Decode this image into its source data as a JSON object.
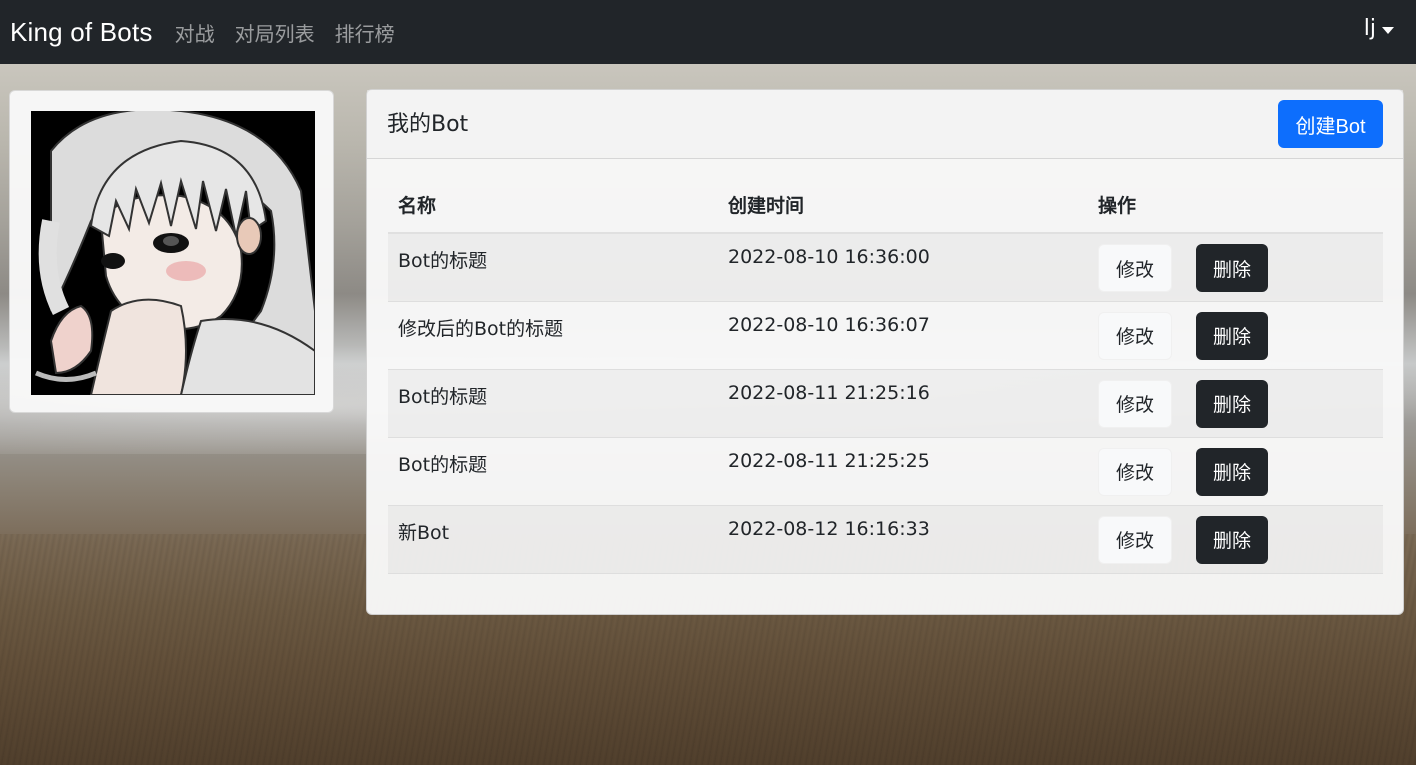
{
  "navbar": {
    "brand": "King of Bots",
    "links": [
      "对战",
      "对局列表",
      "排行榜"
    ],
    "user": "lj"
  },
  "bot_panel": {
    "title": "我的Bot",
    "create_button": "创建Bot",
    "columns": [
      "名称",
      "创建时间",
      "操作"
    ],
    "rows": [
      {
        "name": "Bot的标题",
        "time": "2022-08-10 16:36:00"
      },
      {
        "name": "修改后的Bot的标题",
        "time": "2022-08-10 16:36:07"
      },
      {
        "name": "Bot的标题",
        "time": "2022-08-11 21:25:16"
      },
      {
        "name": "Bot的标题",
        "time": "2022-08-11 21:25:25"
      },
      {
        "name": "新Bot",
        "time": "2022-08-12 16:16:33"
      }
    ],
    "edit_label": "修改",
    "delete_label": "删除"
  },
  "colors": {
    "navbar_bg": "#212529",
    "primary": "#0d6efd",
    "dark_button": "#212529"
  },
  "icons": {
    "user_menu_caret": "caret-down-icon",
    "avatar": "anime-girl-avatar-illustration"
  }
}
